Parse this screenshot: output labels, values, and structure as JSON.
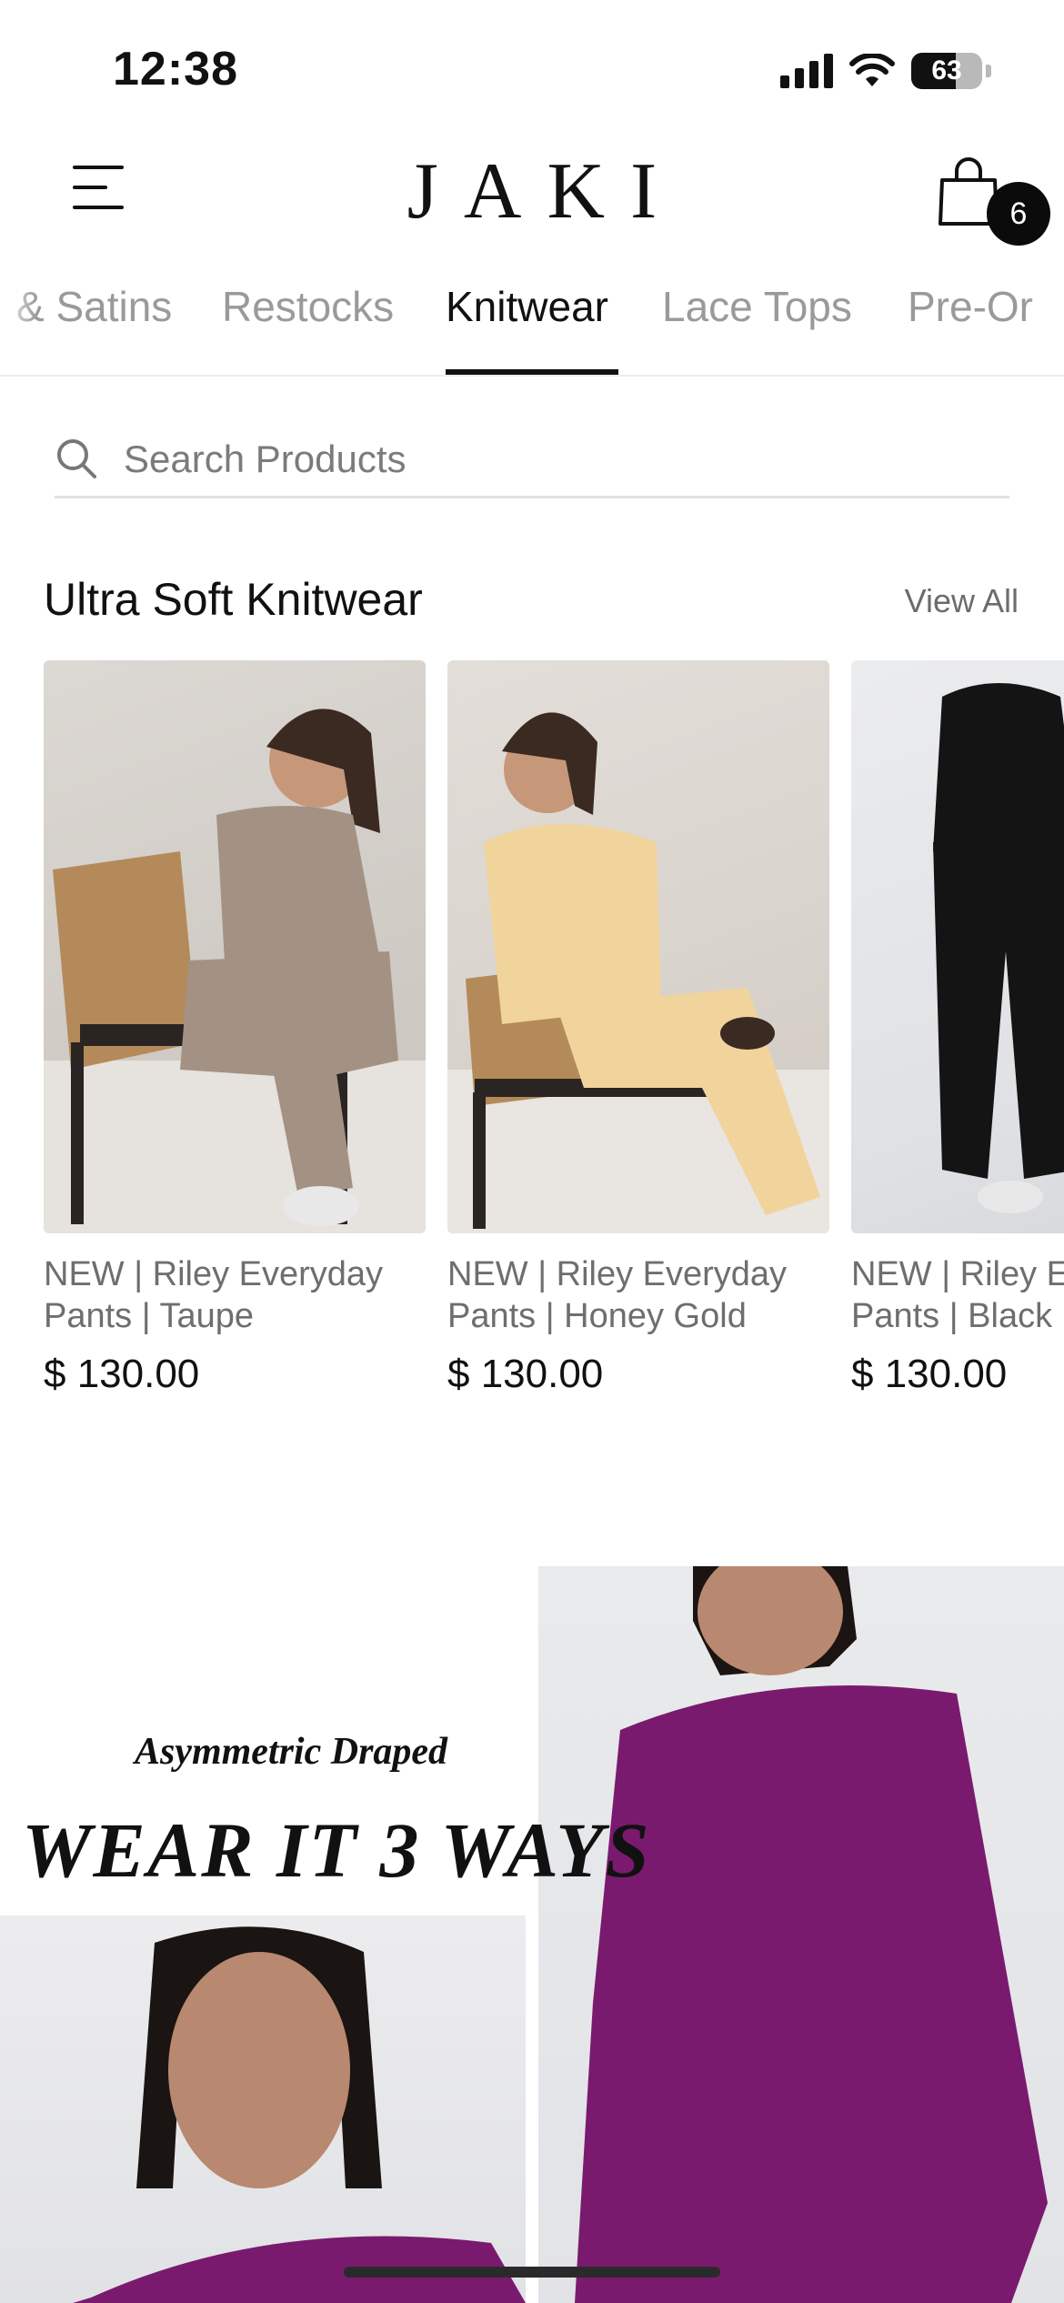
{
  "status_bar": {
    "time": "12:38",
    "battery_level": "63",
    "battery_fraction": 0.63
  },
  "header": {
    "brand": "JAKI",
    "cart_count": "6"
  },
  "tabs": {
    "items": [
      {
        "label": "& Satins",
        "active": false
      },
      {
        "label": "Restocks",
        "active": false
      },
      {
        "label": "Knitwear",
        "active": true
      },
      {
        "label": "Lace Tops",
        "active": false
      },
      {
        "label": "Pre-Or",
        "active": false
      }
    ]
  },
  "search": {
    "placeholder": "Search Products",
    "value": ""
  },
  "section": {
    "title": "Ultra Soft Knitwear",
    "view_all_label": "View All"
  },
  "products": [
    {
      "title": "NEW | Riley Everyday Pants | Taupe",
      "price": "$ 130.00",
      "garment_color": "#a39284"
    },
    {
      "title": "NEW | Riley Everyday Pants | Honey Gold",
      "price": "$ 130.00",
      "garment_color": "#f1d39c"
    },
    {
      "title": "NEW | Riley Everyday Pants | Black",
      "price": "$ 130.00",
      "garment_color": "#141414"
    }
  ],
  "banner": {
    "subtitle": "Asymmetric Draped",
    "title": "WEAR IT 3 WAYS",
    "garment_color": "#7a1a6f"
  },
  "colors": {
    "text_primary": "#111111",
    "text_muted": "#9a9a9a",
    "badge_bg": "#0b0b0b"
  }
}
